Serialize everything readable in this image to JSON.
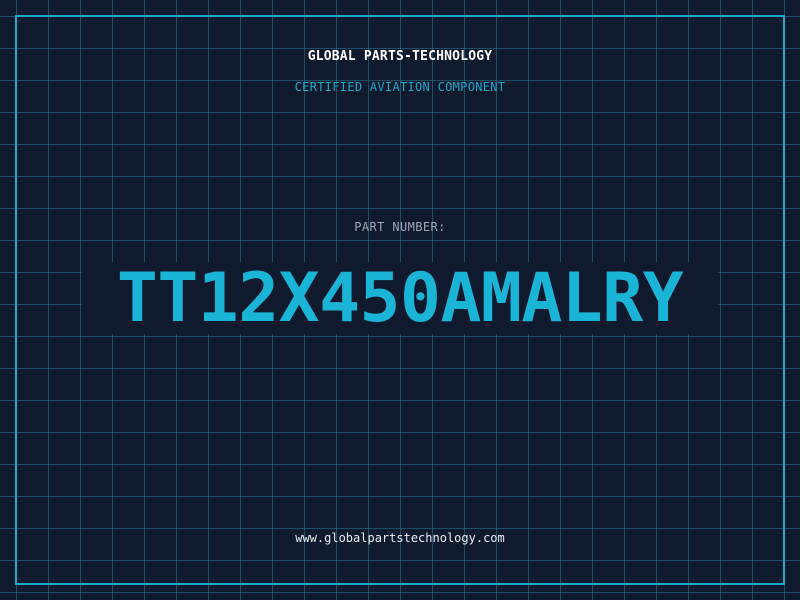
{
  "header": {
    "company": "GLOBAL PARTS-TECHNOLOGY",
    "tagline": "CERTIFIED AVIATION COMPONENT"
  },
  "part": {
    "label": "PART NUMBER:",
    "number": "TT12X450AMALRY"
  },
  "footer": {
    "website": "www.globalpartstechnology.com"
  },
  "colors": {
    "background": "#101a2e",
    "accent": "#1ab4d6",
    "grid": "#28789a",
    "label": "#9aa7b8",
    "text": "#ffffff"
  }
}
